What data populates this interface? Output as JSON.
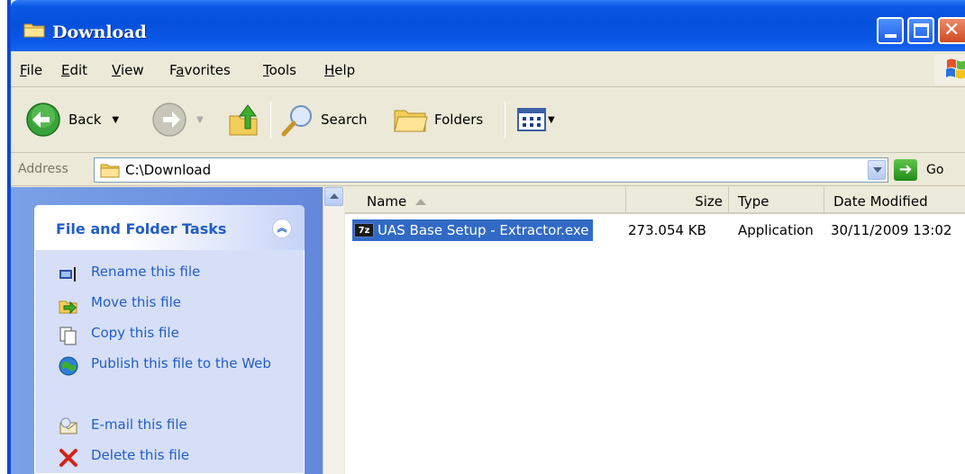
{
  "window": {
    "title": "Download"
  },
  "menubar": [
    {
      "label": "File",
      "key": "F",
      "rest": "ile"
    },
    {
      "label": "Edit",
      "key": "E",
      "rest": "dit"
    },
    {
      "label": "View",
      "key": "V",
      "rest": "iew"
    },
    {
      "label": "Favorites",
      "key": "a",
      "pre": "F",
      "rest": "vorites"
    },
    {
      "label": "Tools",
      "key": "T",
      "rest": "ools"
    },
    {
      "label": "Help",
      "key": "H",
      "rest": "elp"
    }
  ],
  "toolbar": {
    "back_label": "Back",
    "search_label": "Search",
    "folders_label": "Folders"
  },
  "address": {
    "label": "Address",
    "value": "C:\\Download",
    "go_label": "Go"
  },
  "taskpane": {
    "title": "File and Folder Tasks",
    "tasks": [
      {
        "label": "Rename this file",
        "icon": "rename-icon"
      },
      {
        "label": "Move this file",
        "icon": "move-icon"
      },
      {
        "label": "Copy this file",
        "icon": "copy-icon"
      },
      {
        "label": "Publish this file to the Web",
        "icon": "publish-web-icon"
      },
      {
        "label": "E-mail this file",
        "icon": "email-icon"
      },
      {
        "label": "Delete this file",
        "icon": "delete-icon"
      }
    ]
  },
  "filelist": {
    "columns": {
      "name": "Name",
      "size": "Size",
      "type": "Type",
      "date": "Date Modified"
    },
    "rows": [
      {
        "icon": "7z",
        "name": "UAS Base Setup - Extractor.exe",
        "size": "273.054 KB",
        "type": "Application",
        "date": "30/11/2009 13:02"
      }
    ]
  }
}
